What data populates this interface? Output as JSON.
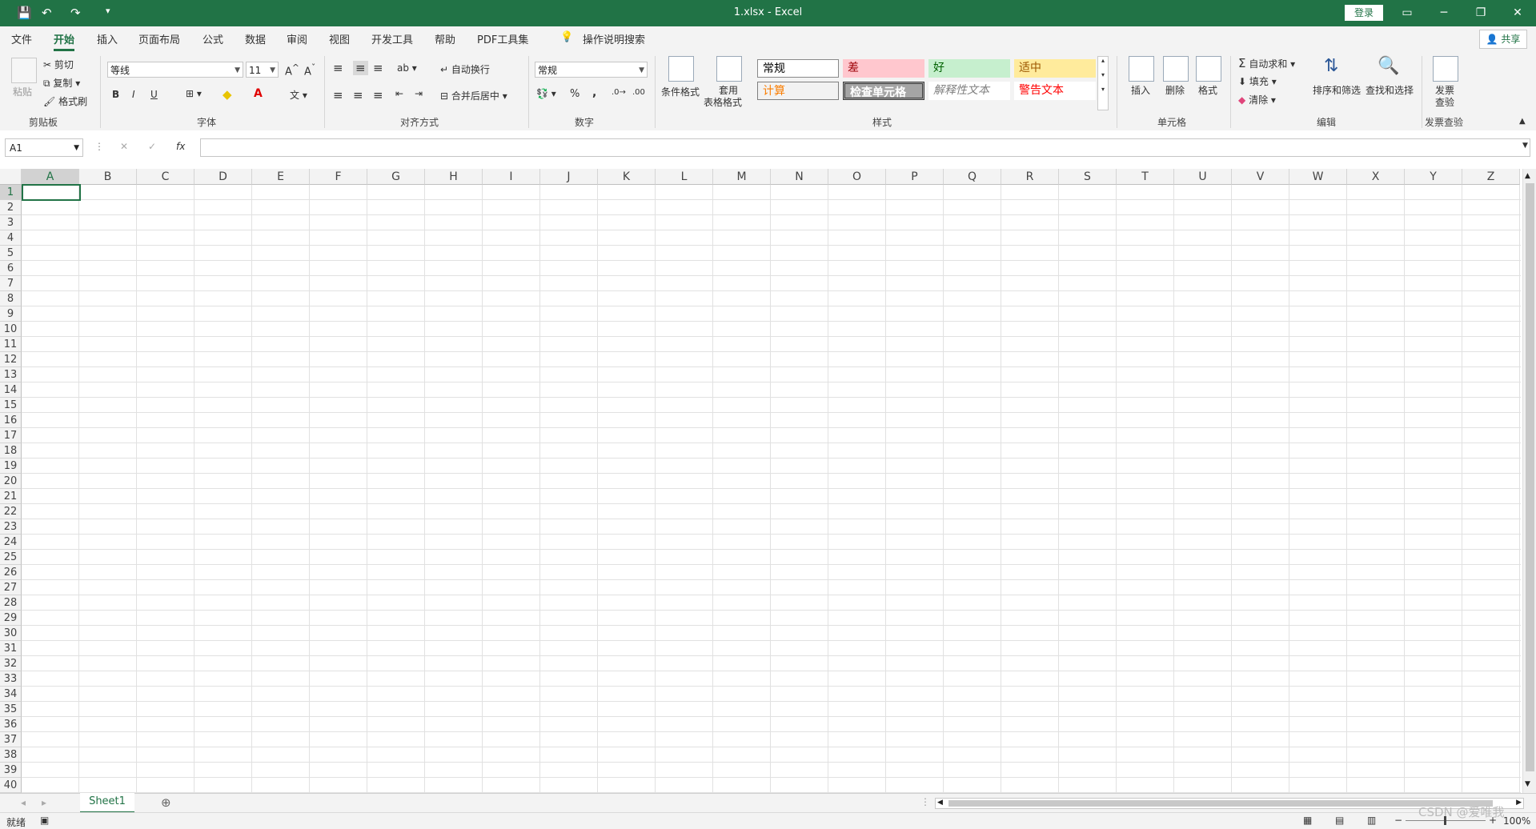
{
  "titlebar": {
    "title": "1.xlsx  -  Excel",
    "login": "登录",
    "icons": [
      "save-icon",
      "undo-icon",
      "redo-icon",
      "customize-qat-icon"
    ],
    "accent": "#217346"
  },
  "tabs": [
    "文件",
    "开始",
    "插入",
    "页面布局",
    "公式",
    "数据",
    "审阅",
    "视图",
    "开发工具",
    "帮助",
    "PDF工具集"
  ],
  "active_tab": "开始",
  "tell_me": "操作说明搜索",
  "share": "共享",
  "ribbon": {
    "clipboard": {
      "paste": "粘贴",
      "cut": "剪切",
      "copy": "复制",
      "format_painter": "格式刷",
      "label": "剪贴板"
    },
    "font": {
      "name": "等线",
      "size": "11",
      "bold": "B",
      "italic": "I",
      "underline": "U",
      "label": "字体"
    },
    "align": {
      "wrap": "自动换行",
      "merge": "合并后居中",
      "label": "对齐方式"
    },
    "number": {
      "format": "常规",
      "percent": "%",
      "comma": ",",
      "label": "数字"
    },
    "styles": {
      "cond_format": "条件格式",
      "table_format_1": "套用",
      "table_format_2": "表格格式",
      "cells": [
        {
          "text": "常规",
          "bg": "#ffffff",
          "color": "#000000"
        },
        {
          "text": "差",
          "bg": "#ffc7ce",
          "color": "#9c0006"
        },
        {
          "text": "好",
          "bg": "#c6efce",
          "color": "#006100"
        },
        {
          "text": "适中",
          "bg": "#ffeb9c",
          "color": "#9c5700"
        },
        {
          "text": "计算",
          "bg": "#f2f2f2",
          "color": "#fa7d00"
        },
        {
          "text": "检查单元格",
          "bg": "#a5a5a5",
          "color": "#ffffff"
        },
        {
          "text": "解释性文本",
          "bg": "#ffffff",
          "color": "#7f7f7f"
        },
        {
          "text": "警告文本",
          "bg": "#ffffff",
          "color": "#ff0000"
        }
      ],
      "label": "样式"
    },
    "cells_group": {
      "insert": "插入",
      "delete": "删除",
      "format": "格式",
      "label": "单元格"
    },
    "editing": {
      "autosum": "自动求和",
      "fill": "填充",
      "clear": "清除",
      "sort": "排序和筛选",
      "find": "查找和选择",
      "label": "编辑"
    },
    "invoice": {
      "check_1": "发票",
      "check_2": "查验",
      "label": "发票查验"
    }
  },
  "formula_bar": {
    "name_box": "A1",
    "fx": "fx",
    "cancel": "✕",
    "enter": "✓"
  },
  "columns": [
    "A",
    "B",
    "C",
    "D",
    "E",
    "F",
    "G",
    "H",
    "I",
    "J",
    "K",
    "L",
    "M",
    "N",
    "O",
    "P",
    "Q",
    "R",
    "S",
    "T",
    "U",
    "V",
    "W",
    "X",
    "Y",
    "Z"
  ],
  "rows": [
    "1",
    "2",
    "3",
    "4",
    "5",
    "6",
    "7",
    "8",
    "9",
    "10",
    "11",
    "12",
    "13",
    "14",
    "15",
    "16",
    "17",
    "18",
    "19",
    "20",
    "21",
    "22",
    "23",
    "24",
    "25",
    "26",
    "27",
    "28",
    "29",
    "30",
    "31",
    "32",
    "33",
    "34",
    "35",
    "36",
    "37",
    "38",
    "39",
    "40"
  ],
  "sheets": [
    "Sheet1"
  ],
  "status": {
    "ready": "就绪",
    "zoom": "100%"
  },
  "watermark": "CSDN @爱唯我"
}
